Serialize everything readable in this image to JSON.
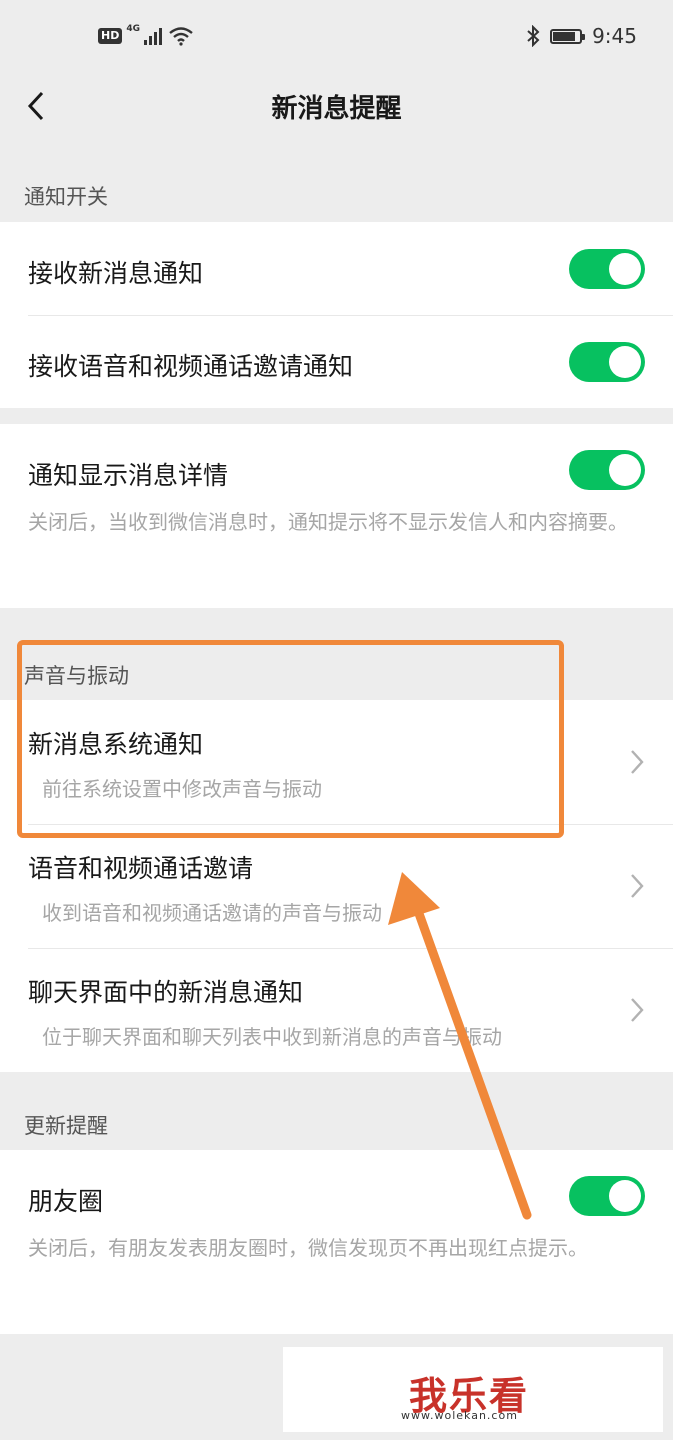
{
  "status_bar": {
    "hd": "HD",
    "network": "4G",
    "time": "9:45",
    "battery_level": 0.85
  },
  "nav": {
    "title": "新消息提醒"
  },
  "sections": {
    "notification_switch": {
      "header": "通知开关",
      "receive_new": {
        "label": "接收新消息通知",
        "on": true
      },
      "receive_call": {
        "label": "接收语音和视频通话邀请通知",
        "on": true
      },
      "show_details": {
        "label": "通知显示消息详情",
        "on": true,
        "desc": "关闭后，当收到微信消息时，通知提示将不显示发信人和内容摘要。"
      }
    },
    "sound_vibration": {
      "header": "声音与振动",
      "system_notify": {
        "label": "新消息系统通知",
        "desc": "前往系统设置中修改声音与振动"
      },
      "call_invite": {
        "label": "语音和视频通话邀请",
        "desc": "收到语音和视频通话邀请的声音与振动"
      },
      "chat_notify": {
        "label": "聊天界面中的新消息通知",
        "desc": "位于聊天界面和聊天列表中收到新消息的声音与振动"
      }
    },
    "update_reminder": {
      "header": "更新提醒",
      "moments": {
        "label": "朋友圈",
        "on": true,
        "desc": "关闭后，有朋友发表朋友圈时，微信发现页不再出现红点提示。"
      }
    }
  },
  "watermark": {
    "logo": "我乐看",
    "url": "www.wolekan.com"
  },
  "colors": {
    "toggle_on": "#07c160",
    "highlight": "#f0883a",
    "background": "#ededed"
  }
}
